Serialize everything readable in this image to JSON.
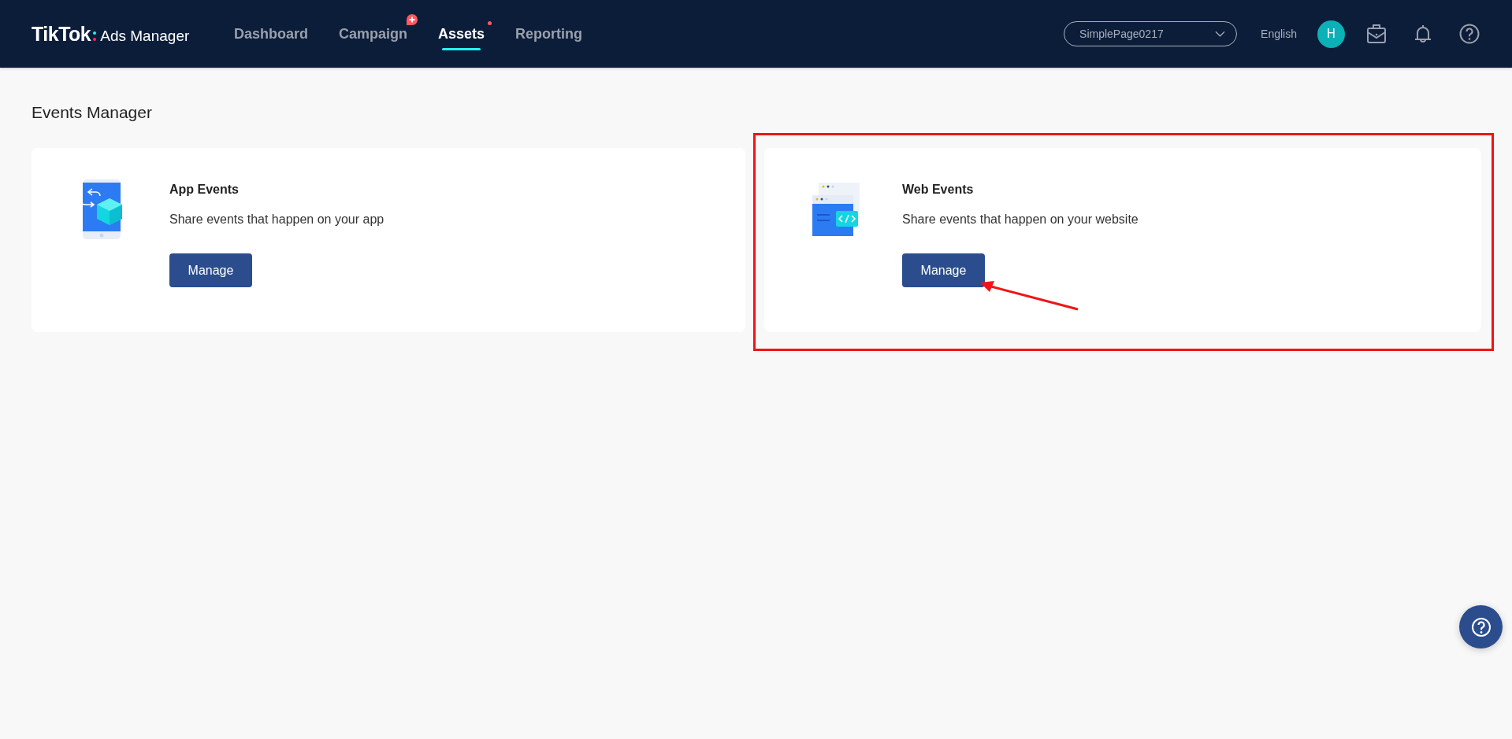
{
  "header": {
    "logo": {
      "brand": "TikTok",
      "product": "Ads Manager"
    },
    "nav": [
      {
        "kind": "plain",
        "label": "Dashboard",
        "selected": false
      },
      {
        "kind": "plus",
        "label": "Campaign",
        "selected": false
      },
      {
        "kind": "dot",
        "label": "Assets",
        "selected": true
      },
      {
        "kind": "plain",
        "label": "Reporting",
        "selected": false
      }
    ],
    "account_select": {
      "value": "SimplePage0217"
    },
    "language": "English",
    "avatar": "H"
  },
  "page": {
    "title": "Events Manager",
    "cards": [
      {
        "kind": "app",
        "title": "App Events",
        "description": "Share events that happen on your app",
        "button": "Manage",
        "highlighted": false
      },
      {
        "kind": "web",
        "title": "Web Events",
        "description": "Share events that happen on your website",
        "button": "Manage",
        "highlighted": true
      }
    ]
  }
}
